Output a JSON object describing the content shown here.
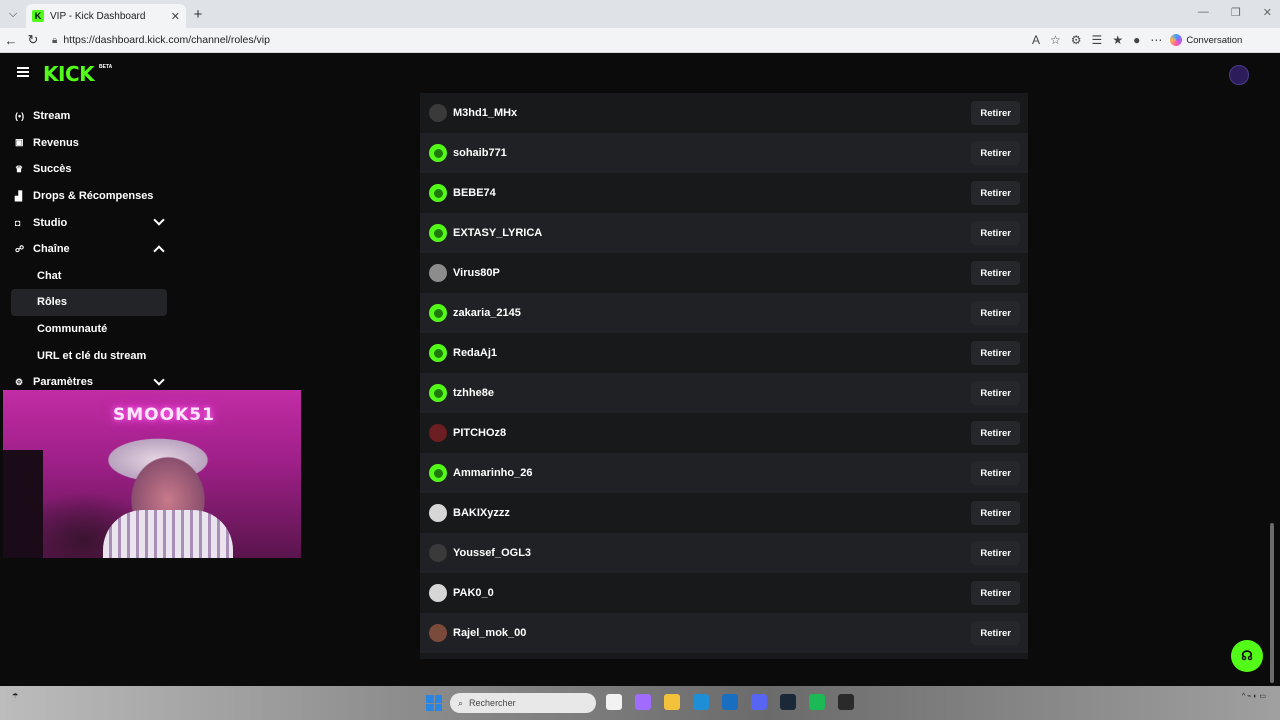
{
  "browser": {
    "tab_title": "VIP - Kick Dashboard",
    "favicon_letter": "K",
    "url": "https://dashboard.kick.com/channel/roles/vip",
    "profile_button": "Conversation"
  },
  "app": {
    "logo": "KICK",
    "logo_badge": "BETA"
  },
  "sidebar": {
    "items": [
      {
        "label": "Stream",
        "icon": "broadcast-icon"
      },
      {
        "label": "Revenus",
        "icon": "revenue-icon"
      },
      {
        "label": "Succès",
        "icon": "trophy-icon"
      },
      {
        "label": "Drops & Récompenses",
        "icon": "chart-icon"
      },
      {
        "label": "Studio",
        "icon": "studio-icon"
      },
      {
        "label": "Chaîne",
        "icon": "users-icon"
      },
      {
        "label": "Chat"
      },
      {
        "label": "Rôles"
      },
      {
        "label": "Communauté"
      },
      {
        "label": "URL et clé du stream"
      },
      {
        "label": "Paramètres",
        "icon": "gear-icon"
      }
    ]
  },
  "webcam": {
    "neon_sign": "SMOOK51"
  },
  "vip_list": {
    "remove_label": "Retirer",
    "users": [
      {
        "name": "M3hd1_MHx"
      },
      {
        "name": "sohaib771"
      },
      {
        "name": "BEBE74"
      },
      {
        "name": "EXTASY_LYRICA"
      },
      {
        "name": "Virus80P"
      },
      {
        "name": "zakaria_2145"
      },
      {
        "name": "RedaAj1"
      },
      {
        "name": "tzhhe8e"
      },
      {
        "name": "PITCHOz8"
      },
      {
        "name": "Ammarinho_26"
      },
      {
        "name": "BAKIXyzzz"
      },
      {
        "name": "Youssef_OGL3"
      },
      {
        "name": "PAK0_0"
      },
      {
        "name": "Rajel_mok_00"
      }
    ]
  },
  "taskbar": {
    "search_placeholder": "Rechercher"
  },
  "colors": {
    "brand": "#53fc18",
    "background": "#0b0b0c",
    "panel": "#18191b"
  }
}
